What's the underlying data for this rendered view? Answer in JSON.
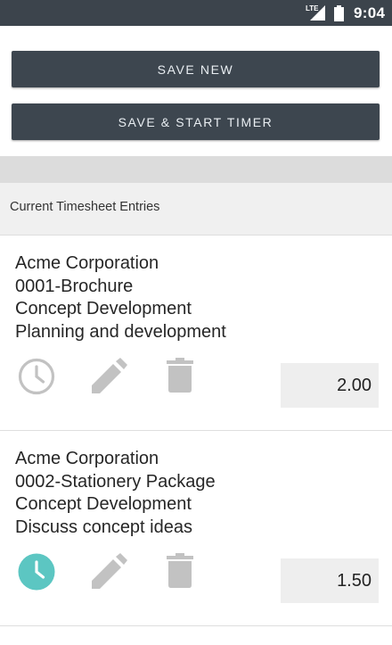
{
  "status_bar": {
    "network_label": "LTE",
    "time": "9:04"
  },
  "actions": {
    "save_new_label": "SAVE NEW",
    "save_start_timer_label": "SAVE & START TIMER"
  },
  "section": {
    "title": "Current Timesheet Entries"
  },
  "entries": [
    {
      "client": "Acme Corporation",
      "project": "0001-Brochure",
      "task": "Concept Development",
      "description": "Planning and development",
      "hours": "2.00",
      "timer_active": false
    },
    {
      "client": "Acme Corporation",
      "project": "0002-Stationery Package",
      "task": "Concept Development",
      "description": "Discuss concept ideas",
      "hours": "1.50",
      "timer_active": true
    }
  ],
  "colors": {
    "status_bar": "#3c444c",
    "button_bg": "#3d464f",
    "timer_active": "#5cc6c2",
    "icon_inactive": "#c2c2c2"
  },
  "icons": {
    "clock": "clock-icon",
    "pencil": "pencil-icon",
    "trash": "trash-icon",
    "signal": "signal-icon",
    "battery": "battery-icon"
  }
}
